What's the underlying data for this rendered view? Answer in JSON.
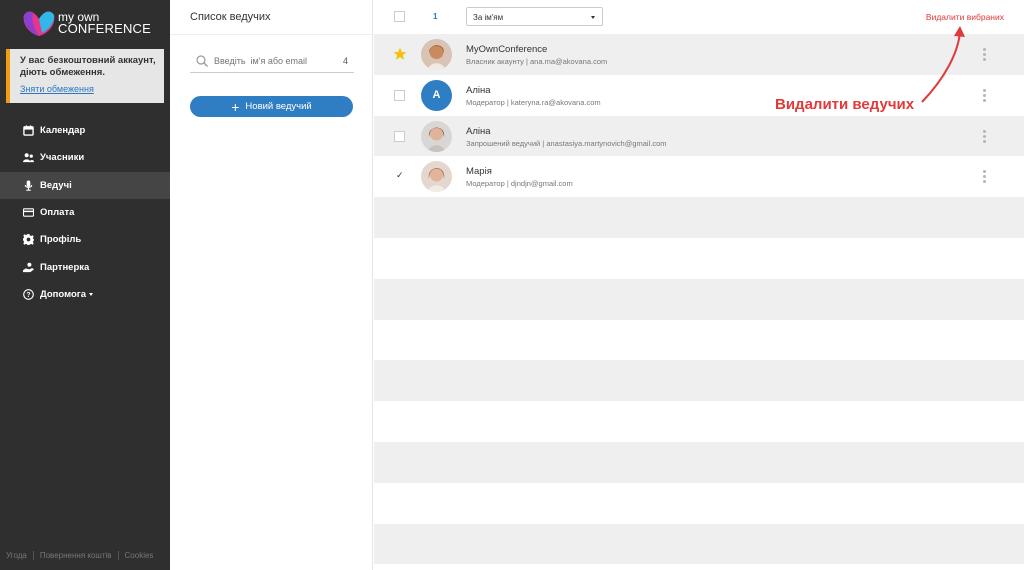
{
  "brand": {
    "line1": "my own",
    "line2": "CONFERENCE"
  },
  "notice": {
    "text": "У вас безкоштовний аккаунт, діють обмеження.",
    "link": "Зняти обмеження"
  },
  "nav": [
    {
      "label": "Календар",
      "icon": "calendar-icon"
    },
    {
      "label": "Учасники",
      "icon": "users-icon"
    },
    {
      "label": "Ведучі",
      "icon": "microphone-icon",
      "active": true
    },
    {
      "label": "Оплата",
      "icon": "card-icon"
    },
    {
      "label": "Профіль",
      "icon": "gear-icon"
    },
    {
      "label": "Партнерка",
      "icon": "partner-icon"
    },
    {
      "label": "Допомога",
      "icon": "help-icon"
    }
  ],
  "footer": {
    "terms": "Угода",
    "refund": "Повернення коштів",
    "cookies": "Cookies"
  },
  "panel": {
    "title": "Список ведучих",
    "search_placeholder": "Введіть  ім'я або email",
    "search_count": "4",
    "new_button": "Новий ведучий"
  },
  "toolbar": {
    "selected_count": "1",
    "sort_value": "За ім'ям",
    "delete_selected": "Видалити вибраних"
  },
  "hosts": [
    {
      "name": "MyOwnConference",
      "role": "Власник акаунту",
      "email": "ana.ma@akovana.com",
      "owner": true,
      "checked": false,
      "avatar": "photo"
    },
    {
      "name": "Аліна",
      "role": "Модератор",
      "email": "kateryna.ra@akovana.com",
      "owner": false,
      "checked": false,
      "avatar": "letter",
      "letter": "A"
    },
    {
      "name": "Аліна",
      "role": "Запрошений ведучий",
      "email": "anastasiya.martynovich@gmail.com",
      "owner": false,
      "checked": false,
      "avatar": "photo"
    },
    {
      "name": "Марія",
      "role": "Модератор",
      "email": "djndjn@gmail.com",
      "owner": false,
      "checked": true,
      "avatar": "photo"
    }
  ],
  "annotation": "Видалити ведучих",
  "colors": {
    "sidebar": "#2f2f2f",
    "accent": "#2f7ec4",
    "danger": "#e03a3a",
    "warning": "#f39c12"
  }
}
